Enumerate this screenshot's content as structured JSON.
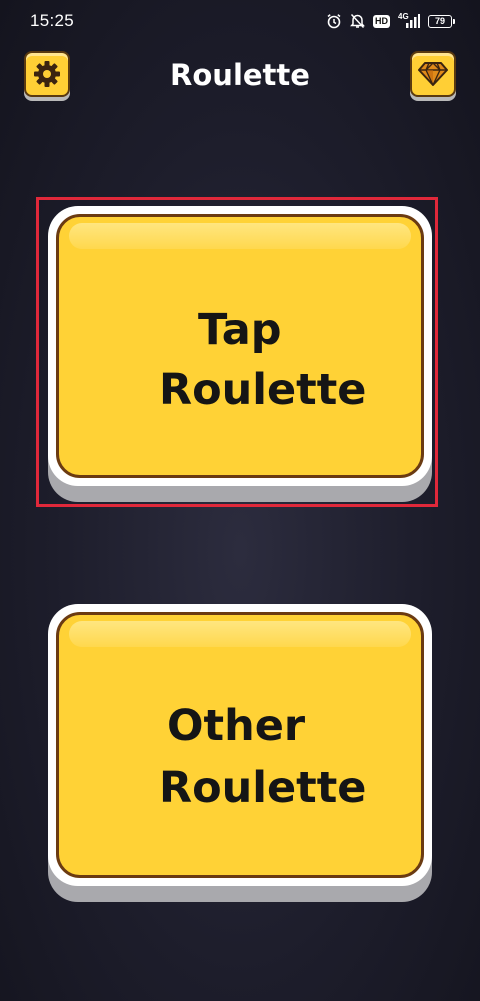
{
  "status_bar": {
    "time": "15:25",
    "network": "4G",
    "hd": "HD",
    "battery": "79",
    "icons": [
      "alarm-icon",
      "bell-off-icon",
      "hd-badge",
      "signal-4g-icon",
      "battery-icon"
    ]
  },
  "header": {
    "title": "Roulette",
    "left_icon": "gear-icon",
    "right_icon": "diamond-icon"
  },
  "buttons": {
    "tap": {
      "line1": "Tap",
      "line2": "Roulette"
    },
    "other": {
      "line1": "Other",
      "line2": "Roulette"
    }
  },
  "colors": {
    "button_fill": "#ffd236",
    "button_border": "#6b3b12",
    "highlight": "#e0283a",
    "background": "#1d1d2b"
  }
}
